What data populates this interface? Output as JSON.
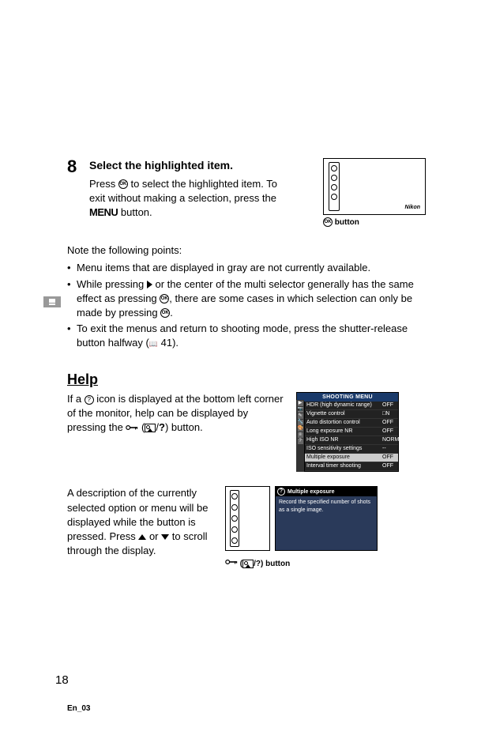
{
  "step": {
    "number": "8",
    "title": "Select the highlighted item.",
    "text_before": "Press ",
    "text_mid": " to select the highlighted item.  To exit without making a selection, press the ",
    "menu_label": "MENU",
    "text_after": " button."
  },
  "diagram1": {
    "brand": "Nikon",
    "caption_suffix": " button"
  },
  "notes": {
    "intro": "Note the following points:",
    "items": [
      "Menu items that are displayed in gray are not currently available.",
      "While pressing ▶ or the center of the multi selector generally has the same effect as pressing ⊛, there are some cases in which selection can only be made by pressing ⊛.",
      "To exit the menus and return to shooting mode, press the shutter-release button halfway (📖 41)."
    ]
  },
  "help": {
    "title": "Help",
    "p1_a": "If a ",
    "p1_b": " icon is displayed at the bottom left corner of the monitor, help can be displayed by pressing the ",
    "p1_c": " button.",
    "p2": "A description of the currently selected option or menu will be displayed while the button is pressed.  Press ▲ or ▼ to scroll through the display.",
    "btn_caption_suffix": ") button"
  },
  "shooting_menu": {
    "header": "SHOOTING MENU",
    "rows": [
      {
        "label": "HDR (high dynamic range)",
        "val": "OFF"
      },
      {
        "label": "Vignette control",
        "val": "□N"
      },
      {
        "label": "Auto distortion control",
        "val": "OFF"
      },
      {
        "label": "Long exposure NR",
        "val": "OFF"
      },
      {
        "label": "High ISO NR",
        "val": "NORM"
      },
      {
        "label": "ISO sensitivity settings",
        "val": "--"
      },
      {
        "label": "Multiple exposure",
        "val": "OFF",
        "sel": true
      },
      {
        "label": "Interval timer shooting",
        "val": "OFF"
      }
    ]
  },
  "help_panel": {
    "title": "Multiple exposure",
    "body": "Record the specified number of shots as a single image."
  },
  "page_number": "18",
  "footer": "En_03"
}
